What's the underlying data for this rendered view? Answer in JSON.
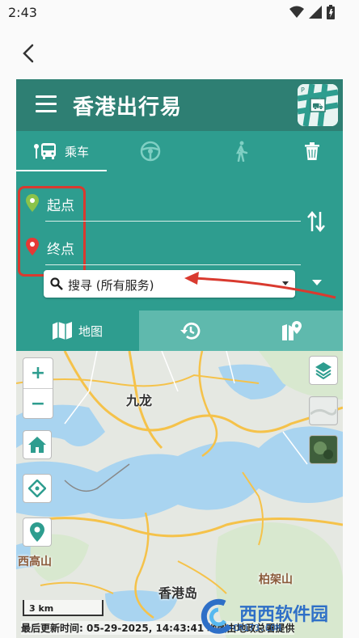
{
  "status": {
    "time": "2:43"
  },
  "app": {
    "title": "香港出行易"
  },
  "mode_tabs": [
    {
      "label": "乘车",
      "icon": "bus-icon"
    },
    {
      "label": "",
      "icon": "steering-wheel-icon"
    },
    {
      "label": "",
      "icon": "walk-icon"
    },
    {
      "label": "",
      "icon": "trash-icon"
    }
  ],
  "route": {
    "start_placeholder": "起点",
    "end_placeholder": "终点",
    "search_text": "搜寻 (所有服务)"
  },
  "view_tabs": [
    {
      "label": "地图",
      "icon": "map-icon"
    },
    {
      "label": "",
      "icon": "history-icon"
    },
    {
      "label": "",
      "icon": "map-pin-icon"
    }
  ],
  "map": {
    "labels": {
      "kowloon": "九龙",
      "hk_island": "香港岛",
      "sai_ko_shan": "西高山",
      "pak_ka_shan": "柏架山"
    },
    "zoom_in": "+",
    "zoom_out": "−",
    "scale": "3 km",
    "last_update": "最后更新时间: 05-29-2025, 14:43:41 地图由地政总署提供"
  },
  "watermark": {
    "text": "西西软件园",
    "sub": "CR173.COM"
  },
  "colors": {
    "primary": "#2e9d8f",
    "dark": "#2e7f73",
    "accent_red": "#d93a2f"
  }
}
